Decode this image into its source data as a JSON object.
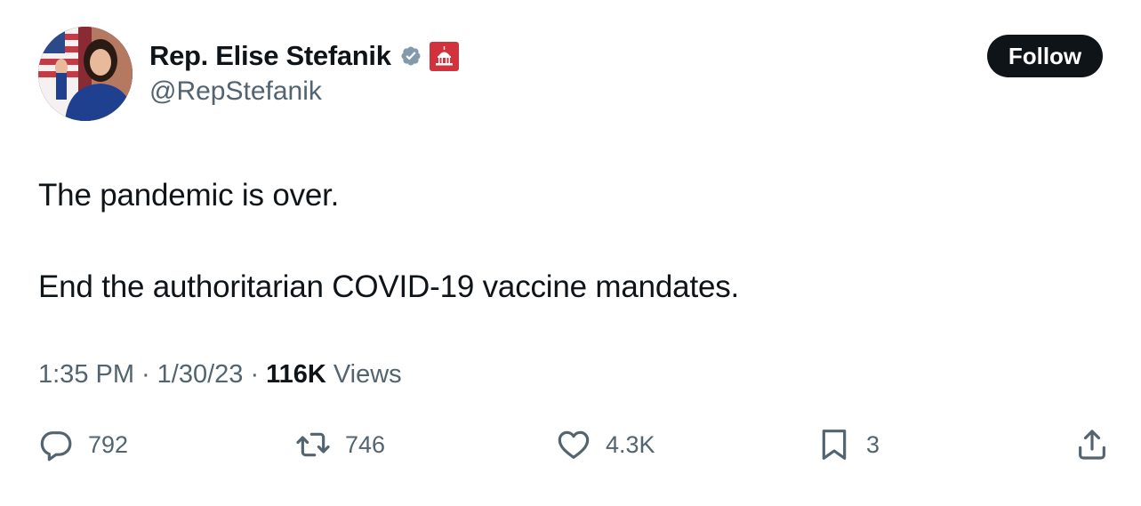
{
  "author": {
    "display_name": "Rep. Elise Stefanik",
    "handle": "@RepStefanik",
    "verified_icon": "verified-badge-icon",
    "affiliation_icon": "us-capitol-badge-icon"
  },
  "follow": {
    "label": "Follow"
  },
  "tweet": {
    "lines": [
      "The pandemic is over.",
      "End the authoritarian COVID-19 vaccine mandates."
    ]
  },
  "meta": {
    "time": "1:35 PM",
    "separator": "·",
    "date": "1/30/23",
    "views_count": "116K",
    "views_label": "Views"
  },
  "actions": {
    "reply": {
      "icon": "reply-icon",
      "count": "792"
    },
    "retweet": {
      "icon": "retweet-icon",
      "count": "746"
    },
    "like": {
      "icon": "heart-icon",
      "count": "4.3K"
    },
    "bookmark": {
      "icon": "bookmark-icon",
      "count": "3"
    },
    "share": {
      "icon": "share-icon"
    }
  },
  "colors": {
    "text_primary": "#0f1419",
    "text_secondary": "#536471",
    "verified_badge": "#829aab",
    "affiliation_badge": "#d1323b",
    "follow_button_bg": "#0f1419",
    "follow_button_text": "#ffffff"
  }
}
